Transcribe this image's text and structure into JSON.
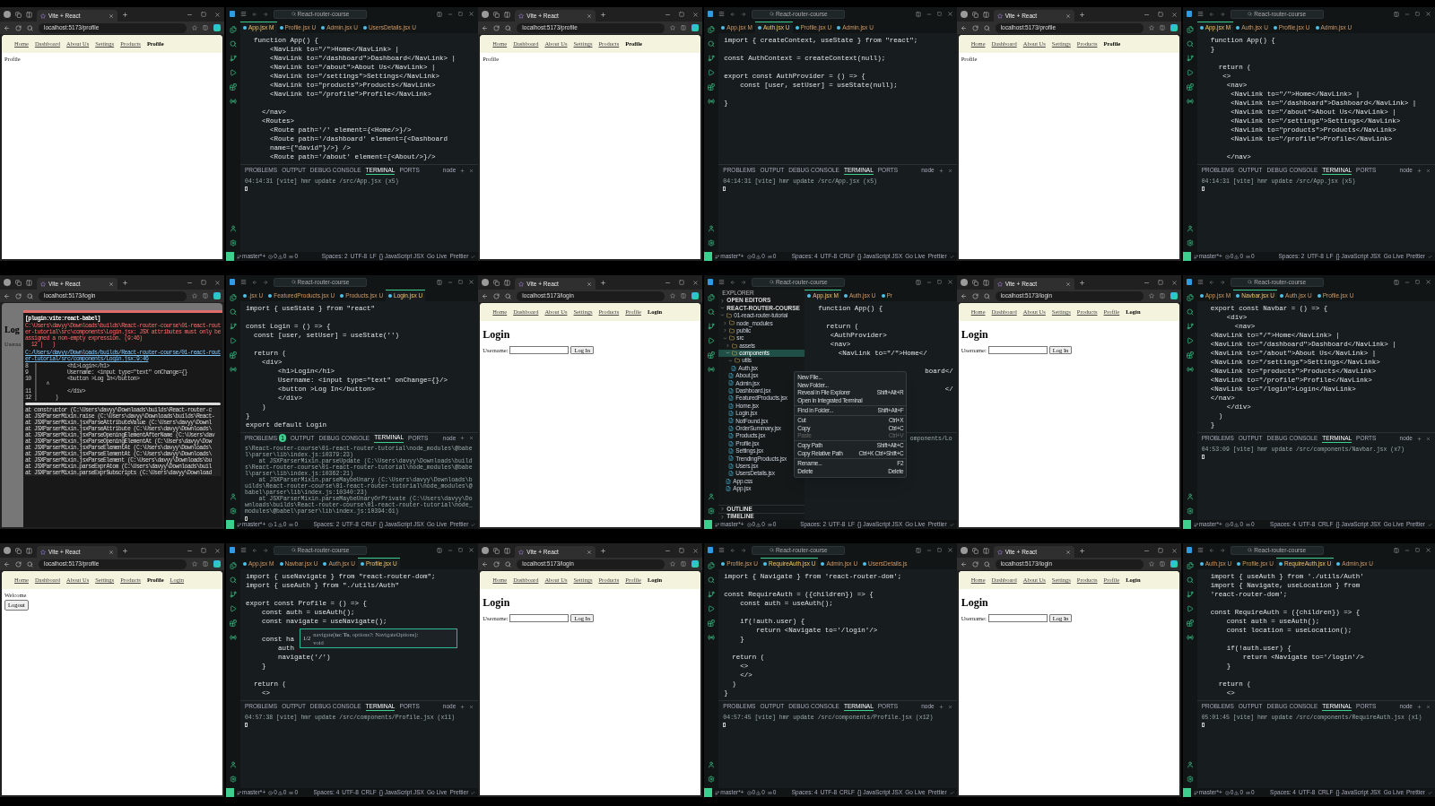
{
  "frames": [
    {
      "browser": {
        "tab_title": "Vite + React",
        "url": "localhost:5173/profile",
        "nav": [
          {
            "label": "Home",
            "selected": false
          },
          {
            "label": "Dashboard",
            "selected": false
          },
          {
            "label": "About Us",
            "selected": false
          },
          {
            "label": "Settings",
            "selected": false
          },
          {
            "label": "Products",
            "selected": false
          },
          {
            "label": "Profile",
            "selected": true
          }
        ],
        "page": [
          {
            "kind": "text",
            "text": "Profile"
          }
        ]
      },
      "editor": {
        "search": "React-router-course",
        "tabs": [
          {
            "label": "App.jsx",
            "status": "M",
            "selected": true
          },
          {
            "label": "Profile.jsx",
            "status": "U",
            "selected": false
          },
          {
            "label": "Admin.jsx",
            "status": "U",
            "selected": false
          },
          {
            "label": "UsersDetails.jsx",
            "status": "U",
            "selected": false
          }
        ],
        "code": [
          {
            "lines": [
              "  function App() {",
              "      <NavLink to=\"/\">Home</NavLink> |",
              "      <NavLink to=\"/dashboard\">Dashboard</NavLink> |",
              "      <NavLink to=\"/about\">About Us</NavLink> |",
              "      <NavLink to=\"/settings\">Settings</NavLink>",
              "      <NavLink to=\"products\">Products</NavLink>",
              "      <NavLink to=\"/profile\">Profile</NavLink>"
            ]
          },
          {
            "lines": [
              "    </nav>",
              "    <Routes>",
              "      <Route path='/' element={<Home/>}/>",
              "      <Route path='/dashboard' element={<Dashboard",
              "      name={\"david\"}/>} />",
              "      <Route path='/about' element={<About/>}/>"
            ]
          }
        ],
        "panel": {
          "tabs": [
            {
              "label": "PROBLEMS",
              "selected": false
            },
            {
              "label": "OUTPUT",
              "selected": false
            },
            {
              "label": "DEBUG CONSOLE",
              "selected": false
            },
            {
              "label": "TERMINAL",
              "selected": true
            },
            {
              "label": "PORTS",
              "selected": false
            }
          ],
          "shell": "node",
          "terminal": [
            "04:14:31 [vite] hmr update /src/App.jsx (x5)"
          ]
        },
        "status_bar": {
          "branch": "master*+",
          "errors": "0",
          "warnings": "0",
          "ports": "0",
          "items": [
            "Spaces: 2",
            "UTF-8",
            "LF",
            "{} JavaScript JSX",
            "Go Live",
            "Prettier"
          ]
        }
      }
    },
    {
      "browser": {
        "tab_title": "Vite + React",
        "url": "localhost:5173/profile",
        "nav": [
          {
            "label": "Home",
            "selected": false
          },
          {
            "label": "Dashboard",
            "selected": false
          },
          {
            "label": "About Us",
            "selected": false
          },
          {
            "label": "Settings",
            "selected": false
          },
          {
            "label": "Products",
            "selected": false
          },
          {
            "label": "Profile",
            "selected": true
          }
        ],
        "page": [
          {
            "kind": "text",
            "text": "Profile"
          }
        ]
      },
      "editor": {
        "search": "React-router-course",
        "tabs": [
          {
            "label": "App.jsx",
            "status": "M",
            "selected": false
          },
          {
            "label": "Auth.jsx",
            "status": "U",
            "selected": true
          },
          {
            "label": "Profile.jsx",
            "status": "U",
            "selected": false
          },
          {
            "label": "Admin.jsx",
            "status": "U",
            "selected": false
          }
        ],
        "code": [
          {
            "lines": [
              "import { createContext, useState } from \"react\";"
            ]
          },
          {
            "lines": [
              "const AuthContext = createContext(null);"
            ]
          },
          {
            "lines": [
              "export const AuthProvider = () => {",
              "    const [user, setUser] = useState(null);"
            ]
          },
          {
            "lines": [
              "}"
            ]
          }
        ],
        "panel": {
          "tabs": [
            {
              "label": "PROBLEMS",
              "selected": false
            },
            {
              "label": "OUTPUT",
              "selected": false
            },
            {
              "label": "DEBUG CONSOLE",
              "selected": false
            },
            {
              "label": "TERMINAL",
              "selected": true
            },
            {
              "label": "PORTS",
              "selected": false
            }
          ],
          "shell": "node",
          "terminal": [
            "04:14:31 [vite] hmr update /src/App.jsx (x5)"
          ]
        },
        "status_bar": {
          "branch": "master*+",
          "errors": "0",
          "warnings": "0",
          "ports": "0",
          "items": [
            "Spaces: 4",
            "UTF-8",
            "CRLF",
            "{} JavaScript JSX",
            "Go Live",
            "Prettier"
          ]
        }
      }
    },
    {
      "browser": {
        "tab_title": "Vite + React",
        "url": "localhost:5173/profile",
        "nav": [
          {
            "label": "Home",
            "selected": false
          },
          {
            "label": "Dashboard",
            "selected": false
          },
          {
            "label": "About Us",
            "selected": false
          },
          {
            "label": "Settings",
            "selected": false
          },
          {
            "label": "Products",
            "selected": false
          },
          {
            "label": "Profile",
            "selected": true
          }
        ],
        "page": [
          {
            "kind": "text",
            "text": "Profile"
          }
        ]
      },
      "editor": {
        "search": "React-router-course",
        "tabs": [
          {
            "label": "App.jsx",
            "status": "M",
            "selected": true
          },
          {
            "label": "Auth.jsx",
            "status": "U",
            "selected": false
          },
          {
            "label": "Profile.jsx",
            "status": "U",
            "selected": false
          },
          {
            "label": "Admin.jsx",
            "status": "U",
            "selected": false
          }
        ],
        "code": [
          {
            "lines": [
              "  function App() {",
              "  }"
            ]
          },
          {
            "lines": [
              "    return (",
              "     <>",
              "      <nav>",
              "       <NavLink to=\"/\">Home</NavLink> |",
              "       <NavLink to=\"/dashboard\">Dashboard</NavLink> |",
              "       <NavLink to=\"/about\">About Us</NavLink> |",
              "       <NavLink to=\"/settings\">Settings</NavLink>",
              "       <NavLink to=\"products\">Products</NavLink>",
              "       <NavLink to=\"/profile\">Profile</NavLink>"
            ]
          },
          {
            "lines": [
              "      </nav>"
            ]
          }
        ],
        "panel": {
          "tabs": [
            {
              "label": "PROBLEMS",
              "selected": false
            },
            {
              "label": "OUTPUT",
              "selected": false
            },
            {
              "label": "DEBUG CONSOLE",
              "selected": false
            },
            {
              "label": "TERMINAL",
              "selected": true
            },
            {
              "label": "PORTS",
              "selected": false
            }
          ],
          "shell": "node",
          "terminal": [
            "04:14:31 [vite] hmr update /src/App.jsx (x5)"
          ]
        },
        "status_bar": {
          "branch": "master*+",
          "errors": "0",
          "warnings": "0",
          "ports": "0",
          "items": [
            "Spaces: 2",
            "UTF-8",
            "LF",
            "{} JavaScript JSX",
            "Go Live",
            "Prettier"
          ]
        }
      }
    },
    {
      "browser": {
        "tab_title": "Vite + React",
        "url": "localhost:5173/login",
        "page": [
          {
            "kind": "heading",
            "text": "Log"
          },
          {
            "kind": "text",
            "text": "Userna"
          }
        ],
        "error_overlay": {
          "plugin": "[plugin:vite:react-babel]",
          "message": "C:\\Users\\davyy\\Downloads\\builds\\React-router-course\\01-react-router-tutorial\\src\\components\\Login.jsx: JSX attributes must only be assigned a non-empty expression. (9:46)",
          "message_tail": "  12 |   )",
          "file_link": "C:/Users/davyy/Downloads/builds/React-router-course/01-react-router-tutorial/src/components/Login.jsx:9:46",
          "frame": [
            "8  |          <h1>Login</h1>",
            "9  |          Username: <input type=\"text\" onChange={}",
            "10 |          <button >Log In</button>",
            "   |   ^",
            "11 |          </div>",
            "12 |      )"
          ],
          "stack": [
            "at constructor (C:\\Users\\davyy\\Downloads\\builds\\React-router-c",
            "at JSXParserMixin.raise (C:\\Users\\davyy\\Downloads\\builds\\React-",
            "at JSXParserMixin.jsxParseAttributeValue (C:\\Users\\davyy\\Downl",
            "at JSXParserMixin.jsxParseAttribute (C:\\Users\\davyy\\Downloads\\",
            "at JSXParserMixin.jsxParseOpeningElementAfterName (C:\\Users\\dav",
            "at JSXParserMixin.jsxParseOpeningElementAt (C:\\Users\\davyy\\Dow",
            "at JSXParserMixin.jsxParseElementAt (C:\\Users\\davyy\\Downloads\\",
            "at JSXParserMixin.jsxParseElementAt (C:\\Users\\davyy\\Downloads\\",
            "at JSXParserMixin.jsxParseElement (C:\\Users\\davyy\\Downloads\\bu",
            "at JSXParserMixin.parseExprAtom (C:\\Users\\davyy\\Downloads\\buil",
            "at JSXParserMixin.parseExprSubscripts (C:\\Users\\davyy\\Download"
          ]
        }
      },
      "editor": {
        "search": "React-router-course",
        "tabs": [
          {
            "label": ".jsx",
            "status": "U",
            "selected": false
          },
          {
            "label": "FeaturedProducts.jsx",
            "status": "U",
            "selected": false
          },
          {
            "label": "Products.jsx",
            "status": "U",
            "selected": false
          },
          {
            "label": "Login.jsx",
            "status": "U",
            "selected": true
          }
        ],
        "code": [
          {
            "lines": [
              "import { useState } from \"react\""
            ]
          },
          {
            "lines": [
              "const Login = () => {",
              "  const [user, setUser] = useState('')"
            ]
          },
          {
            "lines": [
              "  return (",
              "    <div>",
              "        <h1>Login</h1>",
              "        Username: <input type=\"text\" onChange={}/>",
              "        <button >Log In</button>",
              "        </div>",
              "    )",
              "}",
              "export default Login"
            ]
          }
        ],
        "panel": {
          "tabs": [
            {
              "label": "PROBLEMS",
              "selected": false,
              "badge": "1"
            },
            {
              "label": "OUTPUT",
              "selected": false
            },
            {
              "label": "DEBUG CONSOLE",
              "selected": false
            },
            {
              "label": "TERMINAL",
              "selected": true
            },
            {
              "label": "PORTS",
              "selected": false
            }
          ],
          "shell": "node",
          "terminal": [
            "s\\React-router-course\\01-react-router-tutorial\\node_modules\\@babel\\parser\\lib\\index.js:10379:23)",
            "    at JSXParserMixin.parseUpdate (C:\\Users\\davyy\\Downloads\\builds\\React-router-course\\01-react-router-tutorial\\node_modules\\@babel\\parser\\lib\\index.js:10362:21)",
            "    at JSXParserMixin.parseMaybeUnary (C:\\Users\\davyy\\Downloads\\builds\\React-router-course\\01-react-router-tutorial\\node_modules\\@babel\\parser\\lib\\index.js:10340:23)",
            "    at JSXParserMixin.parseMaybeUnaryOrPrivate (C:\\Users\\davyy\\Downloads\\builds\\React-router-course\\01-react-router-tutorial\\node_modules\\@babel\\parser\\lib\\index.js:10394:61)"
          ]
        },
        "status_bar": {
          "branch": "master*+",
          "errors": "1",
          "warnings": "0",
          "ports": "0",
          "items": [
            "Spaces: 2",
            "UTF-8",
            "CRLF",
            "{} JavaScript JSX",
            "Go Live",
            "Prettier"
          ]
        }
      }
    },
    {
      "browser": {
        "tab_title": "Vite + React",
        "url": "localhost:5173/login",
        "nav": [
          {
            "label": "Home",
            "selected": false
          },
          {
            "label": "Dashboard",
            "selected": false
          },
          {
            "label": "About Us",
            "selected": false
          },
          {
            "label": "Settings",
            "selected": false
          },
          {
            "label": "Products",
            "selected": false
          },
          {
            "label": "Profile",
            "selected": false
          },
          {
            "label": "Login",
            "selected": true
          }
        ],
        "page": [
          {
            "kind": "heading",
            "text": "Login"
          },
          {
            "kind": "form",
            "label": "Username:",
            "button": "Log In"
          }
        ]
      },
      "editor": {
        "search": "React-router-course",
        "tabs": [
          {
            "label": "App.jsx",
            "status": "M",
            "selected": true
          },
          {
            "label": "Auth.jsx",
            "status": "U",
            "selected": false
          },
          {
            "label": "Pr",
            "selected": false
          }
        ],
        "explorer": {
          "title": "EXPLORER",
          "sections": [
            {
              "label": "OPEN EDITORS",
              "expanded": false
            },
            {
              "label": "REACT-ROUTER-COURSE",
              "expanded": true
            }
          ],
          "tree": [
            {
              "label": "01-react-router-tutorial",
              "kind": "folder",
              "expanded": true,
              "selected": false,
              "children": [
                {
                  "label": "node_modules",
                  "kind": "folder",
                  "expanded": false,
                  "selected": false
                },
                {
                  "label": "public",
                  "kind": "folder",
                  "expanded": false,
                  "selected": false
                },
                {
                  "label": "src",
                  "kind": "folder",
                  "expanded": true,
                  "selected": false,
                  "children": [
                    {
                      "label": "assets",
                      "kind": "folder",
                      "expanded": false,
                      "selected": false
                    },
                    {
                      "label": "components",
                      "kind": "folder",
                      "expanded": true,
                      "selected": true,
                      "children": [
                        {
                          "label": "utils",
                          "kind": "folder",
                          "expanded": true,
                          "selected": false,
                          "children": [
                            {
                              "label": "Auth.jsx",
                              "kind": "file",
                              "selected": false
                            }
                          ]
                        },
                        {
                          "label": "About.jsx",
                          "kind": "file",
                          "selected": false
                        },
                        {
                          "label": "Admin.jsx",
                          "kind": "file",
                          "selected": false
                        },
                        {
                          "label": "Dashboard.jsx",
                          "kind": "file",
                          "selected": false
                        },
                        {
                          "label": "FeaturedProducts.jsx",
                          "kind": "file",
                          "selected": false
                        },
                        {
                          "label": "Home.jsx",
                          "kind": "file",
                          "selected": false
                        },
                        {
                          "label": "Login.jsx",
                          "kind": "file",
                          "selected": false
                        },
                        {
                          "label": "NotFound.jsx",
                          "kind": "file",
                          "selected": false
                        },
                        {
                          "label": "OrderSummary.jsx",
                          "kind": "file",
                          "selected": false
                        },
                        {
                          "label": "Products.jsx",
                          "kind": "file",
                          "selected": false
                        },
                        {
                          "label": "Profile.jsx",
                          "kind": "file",
                          "selected": false
                        },
                        {
                          "label": "Settings.jsx",
                          "kind": "file",
                          "selected": false
                        },
                        {
                          "label": "TrendingProducts.jsx",
                          "kind": "file",
                          "selected": false
                        },
                        {
                          "label": "Users.jsx",
                          "kind": "file",
                          "selected": false
                        },
                        {
                          "label": "UsersDetails.jsx",
                          "kind": "file",
                          "selected": false
                        }
                      ]
                    },
                    {
                      "label": "App.css",
                      "kind": "file",
                      "selected": false
                    },
                    {
                      "label": "App.jsx",
                      "kind": "file",
                      "selected": false
                    }
                  ]
                }
              ]
            }
          ],
          "footer": [
            "OUTLINE",
            "TIMELINE"
          ]
        },
        "context_menu": [
          [
            {
              "label": "New File...",
              "disabled": false
            },
            {
              "label": "New Folder...",
              "disabled": false
            },
            {
              "label": "Reveal in File Explorer",
              "shortcut": "Shift+Alt+R",
              "disabled": false
            },
            {
              "label": "Open in Integrated Terminal",
              "disabled": false
            }
          ],
          [
            {
              "label": "Find in Folder...",
              "shortcut": "Shift+Alt+F",
              "disabled": false
            }
          ],
          [
            {
              "label": "Cut",
              "shortcut": "Ctrl+X",
              "disabled": false
            },
            {
              "label": "Copy",
              "shortcut": "Ctrl+C",
              "disabled": false
            },
            {
              "label": "Paste",
              "shortcut": "Ctrl+V",
              "disabled": true
            }
          ],
          [
            {
              "label": "Copy Path",
              "shortcut": "Shift+Alt+C",
              "disabled": false
            },
            {
              "label": "Copy Relative Path",
              "shortcut": "Ctrl+K Ctrl+Shift+C",
              "disabled": false
            }
          ],
          [
            {
              "label": "Rename...",
              "shortcut": "F2",
              "disabled": false
            },
            {
              "label": "Delete",
              "shortcut": "Delete",
              "disabled": false
            }
          ]
        ],
        "code": [
          {
            "lines": [
              "  function App() {"
            ]
          },
          {
            "lines": [
              "    return (",
              "     <AuthProvider>",
              "     <nav>",
              "       <NavLink to=\"/\">Home</"
            ]
          },
          {
            "kind": "fragment",
            "lines": [
              "board</"
            ]
          },
          {
            "kind": "fragment",
            "lines": [
              "</"
            ]
          }
        ],
        "panel": {
          "terminal": [
            "omponents/Lo"
          ]
        },
        "status_bar": {
          "branch": "master*+",
          "errors": "0",
          "warnings": "0",
          "ports": "0",
          "items": [
            "Spaces: 2",
            "UTF-8",
            "LF",
            "{} JavaScript JSX",
            "Go Live",
            "Prettier"
          ]
        }
      }
    },
    {
      "browser": {
        "tab_title": "Vite + React",
        "url": "localhost:5173/login",
        "nav": [
          {
            "label": "Home",
            "selected": false
          },
          {
            "label": "Dashboard",
            "selected": false
          },
          {
            "label": "About Us",
            "selected": false
          },
          {
            "label": "Settings",
            "selected": false
          },
          {
            "label": "Products",
            "selected": false
          },
          {
            "label": "Profile",
            "selected": false
          },
          {
            "label": "Login",
            "selected": true
          }
        ],
        "page": [
          {
            "kind": "heading",
            "text": "Login"
          },
          {
            "kind": "form",
            "label": "Username:",
            "button": "Log In"
          }
        ]
      },
      "editor": {
        "search": "React-router-course",
        "tabs": [
          {
            "label": "App.jsx",
            "status": "M",
            "selected": false
          },
          {
            "label": "Navbar.jsx",
            "status": "U",
            "selected": true
          },
          {
            "label": "Auth.jsx",
            "status": "U",
            "selected": false
          },
          {
            "label": "Profile.jsx",
            "status": "U",
            "selected": false
          }
        ],
        "code": [
          {
            "lines": [
              "  export const Navbar = () => {",
              "      <div>",
              "        <nav>",
              "  <NavLink to=\"/\">Home</NavLink> |",
              "  <NavLink to=\"/dashboard\">Dashboard</NavLink> |",
              "  <NavLink to=\"/about\">About Us</NavLink> |",
              "  <NavLink to=\"/settings\">Settings</NavLink>",
              "  <NavLink to=\"products\">Products</NavLink>",
              "  <NavLink to=\"/profile\">Profile</NavLink>",
              "  <NavLink to=\"/login\">Login</NavLink>",
              "  </nav>",
              "      </div>",
              "    )",
              "  }"
            ]
          }
        ],
        "panel": {
          "tabs": [
            {
              "label": "PROBLEMS",
              "selected": false
            },
            {
              "label": "OUTPUT",
              "selected": false
            },
            {
              "label": "DEBUG CONSOLE",
              "selected": false
            },
            {
              "label": "TERMINAL",
              "selected": true
            },
            {
              "label": "PORTS",
              "selected": false
            }
          ],
          "shell": "node",
          "terminal": [
            "04:53:09 [vite] hmr update /src/components/Navbar.jsx (x7)"
          ]
        },
        "status_bar": {
          "branch": "master*+",
          "errors": "0",
          "warnings": "0",
          "ports": "0",
          "items": [
            "Spaces: 4",
            "UTF-8",
            "CRLF",
            "{} JavaScript JSX",
            "Go Live",
            "Prettier"
          ]
        }
      }
    },
    {
      "browser": {
        "tab_title": "Vite + React",
        "url": "localhost:5173/profile",
        "nav": [
          {
            "label": "Home",
            "selected": false
          },
          {
            "label": "Dashboard",
            "selected": false
          },
          {
            "label": "About Us",
            "selected": false
          },
          {
            "label": "Settings",
            "selected": false
          },
          {
            "label": "Products",
            "selected": false
          },
          {
            "label": "Profile",
            "selected": true
          },
          {
            "label": "Login",
            "selected": false
          }
        ],
        "page": [
          {
            "kind": "text",
            "text": "Welcome"
          },
          {
            "kind": "button",
            "text": "Logout"
          }
        ]
      },
      "editor": {
        "search": "React-router-course",
        "tabs": [
          {
            "label": "App.jsx",
            "status": "M",
            "selected": false
          },
          {
            "label": "Navbar.jsx",
            "status": "U",
            "selected": false
          },
          {
            "label": "Auth.jsx",
            "status": "U",
            "selected": false
          },
          {
            "label": "Profile.jsx",
            "status": "U",
            "selected": true
          }
        ],
        "code": [
          {
            "lines": [
              "import { useNavigate } from \"react-router-dom\";",
              "import { useAuth } from \"./utils/Auth\""
            ]
          },
          {
            "lines": [
              "export const Profile = () => {",
              "    const auth = useAuth();",
              "    const navigate = useNavigate();"
            ]
          },
          {
            "lines": [
              "    const ha",
              "        auth",
              "        navigate('/')",
              "    }"
            ]
          },
          {
            "lines": [
              "  return (",
              "    <>"
            ]
          }
        ],
        "tooltip": {
          "counter": "1/2",
          "signature": "navigate(**to: To**, options?: NavigateOptions):",
          "returns": "void"
        },
        "panel": {
          "tabs": [
            {
              "label": "PROBLEMS",
              "selected": false
            },
            {
              "label": "OUTPUT",
              "selected": false
            },
            {
              "label": "DEBUG CONSOLE",
              "selected": false
            },
            {
              "label": "TERMINAL",
              "selected": true
            },
            {
              "label": "PORTS",
              "selected": false
            }
          ],
          "shell": "node",
          "terminal": [
            "04:57:38 [vite] hmr update /src/components/Profile.jsx (x11)"
          ]
        },
        "status_bar": {
          "branch": "master*+",
          "errors": "0",
          "warnings": "0",
          "ports": "0",
          "items": [
            "Spaces: 4",
            "UTF-8",
            "CRLF",
            "{} JavaScript JSX",
            "Go Live",
            "Prettier"
          ]
        }
      }
    },
    {
      "browser": {
        "tab_title": "Vite + React",
        "url": "localhost:5173/login",
        "nav": [
          {
            "label": "Home",
            "selected": false
          },
          {
            "label": "Dashboard",
            "selected": false
          },
          {
            "label": "About Us",
            "selected": false
          },
          {
            "label": "Settings",
            "selected": false
          },
          {
            "label": "Products",
            "selected": false
          },
          {
            "label": "Profile",
            "selected": false
          },
          {
            "label": "Login",
            "selected": true
          }
        ],
        "page": [
          {
            "kind": "heading",
            "text": "Login"
          },
          {
            "kind": "form",
            "label": "Username:",
            "button": "Log In"
          }
        ]
      },
      "editor": {
        "search": "React-router-course",
        "tabs": [
          {
            "label": "Profile.jsx",
            "status": "U",
            "selected": false
          },
          {
            "label": "RequireAuth.jsx",
            "status": "U",
            "selected": true
          },
          {
            "label": "Admin.jsx",
            "status": "U",
            "selected": false
          },
          {
            "label": "UsersDetails.js",
            "selected": false
          }
        ],
        "code": [
          {
            "lines": [
              "import { Navigate } from 'react-router-dom';"
            ]
          },
          {
            "lines": [
              "const RequireAuth = ({children}) => {",
              "    const auth = useAuth();"
            ]
          },
          {
            "lines": [
              "    if(!auth.user) {",
              "        return <Navigate to='/login'/>",
              "    }"
            ]
          },
          {
            "lines": [
              "  return (",
              "    <>",
              "    </>",
              "  )",
              "}"
            ]
          }
        ],
        "panel": {
          "tabs": [
            {
              "label": "PROBLEMS",
              "selected": false
            },
            {
              "label": "OUTPUT",
              "selected": false
            },
            {
              "label": "DEBUG CONSOLE",
              "selected": false
            },
            {
              "label": "TERMINAL",
              "selected": true
            },
            {
              "label": "PORTS",
              "selected": false
            }
          ],
          "shell": "node",
          "terminal": [
            "04:57:45 [vite] hmr update /src/components/Profile.jsx (x12)"
          ]
        },
        "status_bar": {
          "branch": "master*+",
          "errors": "0",
          "warnings": "0",
          "ports": "0",
          "items": [
            "Spaces: 4",
            "UTF-8",
            "CRLF",
            "{} JavaScript JSX",
            "Go Live",
            "Prettier"
          ]
        }
      }
    },
    {
      "browser": {
        "tab_title": "Vite + React",
        "url": "localhost:5173/login",
        "nav": [
          {
            "label": "Home",
            "selected": false
          },
          {
            "label": "Dashboard",
            "selected": false
          },
          {
            "label": "About Us",
            "selected": false
          },
          {
            "label": "Settings",
            "selected": false
          },
          {
            "label": "Products",
            "selected": false
          },
          {
            "label": "Profile",
            "selected": false
          },
          {
            "label": "Login",
            "selected": true
          }
        ],
        "page": [
          {
            "kind": "heading",
            "text": "Login"
          },
          {
            "kind": "form",
            "label": "Username:",
            "button": "Log In"
          }
        ]
      },
      "editor": {
        "search": "React-router-course",
        "tabs": [
          {
            "label": "Auth.jsx",
            "status": "U",
            "selected": false
          },
          {
            "label": "Profile.jsx",
            "status": "U",
            "selected": false
          },
          {
            "label": "RequireAuth.jsx",
            "status": "U",
            "selected": true
          },
          {
            "label": "Admin.jsx",
            "status": "U",
            "selected": false
          }
        ],
        "code": [
          {
            "lines": [
              "  import { useAuth } from './utils/Auth'",
              "  import { Navigate, useLocation } from",
              "  'react-router-dom';"
            ]
          },
          {
            "lines": [
              "  const RequireAuth = ({children}) => {",
              "      const auth = useAuth();",
              "      const location = useLocation();"
            ]
          },
          {
            "lines": [
              "      if(!auth.user) {",
              "          return <Navigate to='/login'/>",
              "      }"
            ]
          },
          {
            "lines": [
              "    return (",
              "      <>"
            ]
          }
        ],
        "panel": {
          "tabs": [
            {
              "label": "PROBLEMS",
              "selected": false
            },
            {
              "label": "OUTPUT",
              "selected": false
            },
            {
              "label": "DEBUG CONSOLE",
              "selected": false
            },
            {
              "label": "TERMINAL",
              "selected": true
            },
            {
              "label": "PORTS",
              "selected": false
            }
          ],
          "shell": "node",
          "terminal": [
            "05:01:45 [vite] hmr update /src/components/RequireAuth.jsx (x1)"
          ]
        },
        "status_bar": {
          "branch": "master*+",
          "errors": "0",
          "warnings": "0",
          "ports": "0",
          "items": [
            "Spaces: 4",
            "UTF-8",
            "CRLF",
            "{} JavaScript JSX",
            "Go Live",
            "Prettier"
          ]
        }
      }
    }
  ]
}
